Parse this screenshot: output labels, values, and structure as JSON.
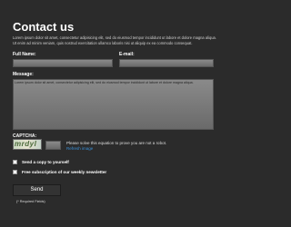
{
  "form": {
    "title": "Contact us",
    "intro": "Lorem ipsum dolor sit amet, consectetur adipisicing elit, sed do eiusmod tempor incididunt ut labore et dolore magna aliqua. Ut enim ad minim veniam, quis nostrud exercitation ullamco laboris nisi ut aliquip ex ea commodo consequat.",
    "full_name_label": "Full Name:",
    "full_name_value": "",
    "email_label": "E-mail:",
    "email_value": "",
    "message_label": "Message:",
    "message_value": "Lorem ipsum dolor sit amet, consectetur adipisicing elit, sed do eiusmod tempor incididunt ut labore et dolore magna aliqua.",
    "captcha_label": "CAPTCHA:",
    "captcha_code": "mrdyl",
    "captcha_value": "",
    "captcha_hint": "Please solve this equation to prove you are not a robot.",
    "refresh_label": "Refresh image",
    "send_copy_label": "Send a copy to yourself",
    "newsletter_label": "Free subscription of our weekly newsletter",
    "send_label": "Send",
    "required_note": "(* Required Fields)"
  },
  "colors": {
    "background": "#2b2b2b",
    "field": "#7a7a7a",
    "link": "#3a8fd6",
    "text": "#ffffff"
  }
}
